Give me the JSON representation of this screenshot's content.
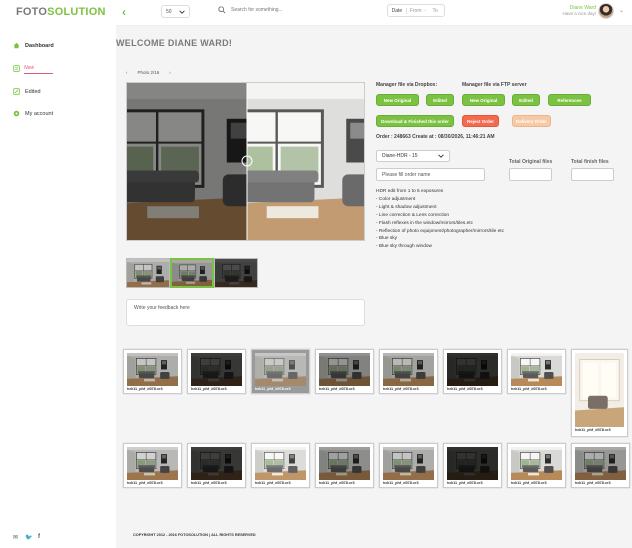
{
  "brand": {
    "part1": "FOTO",
    "part2": "SOLUTION"
  },
  "sidebar": {
    "items": [
      {
        "label": "Dashboard",
        "icon": "home-icon"
      },
      {
        "label": "Edited",
        "icon": "edit-icon"
      },
      {
        "label": "My account",
        "icon": "gear-icon"
      }
    ],
    "new": {
      "label": "New",
      "icon": "inbox-icon"
    }
  },
  "topbar": {
    "page_size": "50",
    "search_placeholder": "Search for something...",
    "date_label": "Date",
    "date_from": "From",
    "date_sep": "-",
    "date_to": "To",
    "user_name": "Diane Ward",
    "user_greeting": "Have a nice day!"
  },
  "main": {
    "welcome": "WELCOME DIANE WARD!",
    "photo_counter": "Photo 2/16",
    "prev": "‹",
    "next": "›",
    "feedback_placeholder": "Write your feedback here",
    "dropbox_title": "Manager file via Dropbox:",
    "ftp_title": "Manager file via FTP server",
    "btn_new_original": "New Original",
    "btn_edited": "Edited",
    "btn_new_original_ftp": "New Original",
    "btn_edited_ftp": "Edited",
    "btn_references": "References",
    "btn_download": "Download & Finished this order",
    "btn_reject": "Reject Order",
    "btn_delivery": "Delivery Order",
    "order_info": "Order : 248663 Create at : 08/30/2026, 11:46:21 AM",
    "hdr_select": "Diane-HDR - 15",
    "order_name_placeholder": "Please fill order name",
    "total_original": "Total Original files",
    "total_finish": "Total finish files",
    "description": [
      "HDR edit from 1 to 5 exposures",
      "- Color adjustment",
      "- Light & shadow adjustment",
      "- Line correction & Lens correction",
      "- Flash reflexes in the window/mirrors/tiles.etc",
      "- Reflection of photo equipment/photographer/mirrors/tile etc",
      "- Blue sky",
      "- Blue sky through window"
    ],
    "file_caption": "hdr11_phf_d078.cr3"
  },
  "footer": {
    "text": "COPYRIGHT 2012 - 2016 FOTOSOLUTION  |  ALL RIGHTS RESERVED"
  },
  "colors": {
    "accent": "#7cc242",
    "reject": "#f36a4e",
    "delivery": "#f8c9a6",
    "new": "#e15b7a"
  }
}
